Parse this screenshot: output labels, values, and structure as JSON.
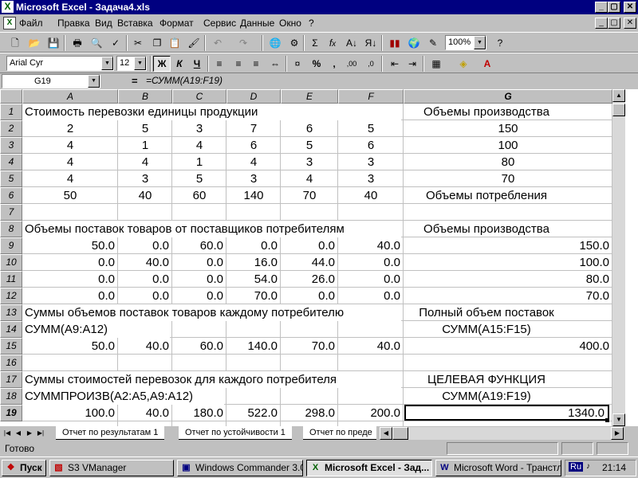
{
  "window": {
    "title": "Microsoft Excel - Задача4.xls",
    "app_icon": "excel-icon"
  },
  "menu": [
    "Файл",
    "Правка",
    "Вид",
    "Вставка",
    "Формат",
    "Сервис",
    "Данные",
    "Окно",
    "?"
  ],
  "formatting": {
    "font": "Arial Cyr",
    "size": "12",
    "zoom": "100%"
  },
  "formula_bar": {
    "cell_ref": "G19",
    "equals": "=",
    "formula": "=СУММ(A19:F19)"
  },
  "columns": [
    "A",
    "B",
    "C",
    "D",
    "E",
    "F",
    "G"
  ],
  "rows": [
    "1",
    "2",
    "3",
    "4",
    "5",
    "6",
    "7",
    "8",
    "9",
    "10",
    "11",
    "12",
    "13",
    "14",
    "15",
    "16",
    "17",
    "18",
    "19"
  ],
  "sheet": {
    "r1_title": "Стоимость перевозки единицы продукции",
    "r1_g": "Объемы производства",
    "cost_matrix": [
      [
        "2",
        "5",
        "3",
        "7",
        "6",
        "5"
      ],
      [
        "4",
        "1",
        "4",
        "6",
        "5",
        "6"
      ],
      [
        "4",
        "4",
        "1",
        "4",
        "3",
        "3"
      ],
      [
        "4",
        "3",
        "5",
        "3",
        "4",
        "3"
      ]
    ],
    "production": [
      "150",
      "100",
      "80",
      "70"
    ],
    "consumption": [
      "50",
      "40",
      "60",
      "140",
      "70",
      "40"
    ],
    "r6_g": "Объемы потребления",
    "r8_title": "Объемы поставок товаров от поставщиков потребителям",
    "r8_g": "Объемы производства",
    "supply_matrix": [
      [
        "50.0",
        "0.0",
        "60.0",
        "0.0",
        "0.0",
        "40.0"
      ],
      [
        "0.0",
        "40.0",
        "0.0",
        "16.0",
        "44.0",
        "0.0"
      ],
      [
        "0.0",
        "0.0",
        "0.0",
        "54.0",
        "26.0",
        "0.0"
      ],
      [
        "0.0",
        "0.0",
        "0.0",
        "70.0",
        "0.0",
        "0.0"
      ]
    ],
    "supply_production": [
      "150.0",
      "100.0",
      "80.0",
      "70.0"
    ],
    "r13_title": "Суммы объемов поставок товаров каждому потребителю",
    "r13_g": "Полный объем поставок",
    "r14_a": "СУММ(A9:A12)",
    "r14_g": "СУММ(A15:F15)",
    "totals": [
      "50.0",
      "40.0",
      "60.0",
      "140.0",
      "70.0",
      "40.0"
    ],
    "r15_g": "400.0",
    "r17_title": "Суммы стоимостей перевозок для каждого потребителя",
    "r17_g": "ЦЕЛЕВАЯ ФУНКЦИЯ",
    "r18_a": "СУММПРОИЗВ(A2:A5,A9:A12)",
    "r18_g": "СУММ(A19:F19)",
    "costs": [
      "100.0",
      "40.0",
      "180.0",
      "522.0",
      "298.0",
      "200.0"
    ],
    "r19_g": "1340.0"
  },
  "sheet_tabs": [
    "Отчет по результатам 1",
    "Отчет по устойчивости 1",
    "Отчет по преде"
  ],
  "status": "Готово",
  "taskbar": {
    "start": "Пуск",
    "tasks": [
      "S3 VManager",
      "Windows Commander 3.0...",
      "Microsoft Excel - Зад...",
      "Microsoft Word - Транстл..."
    ],
    "lang": "Ru",
    "clock": "21:14"
  },
  "colors": {
    "titlebar": "#000080",
    "face": "#c0c0c0",
    "grid": "#c0c0c0"
  }
}
